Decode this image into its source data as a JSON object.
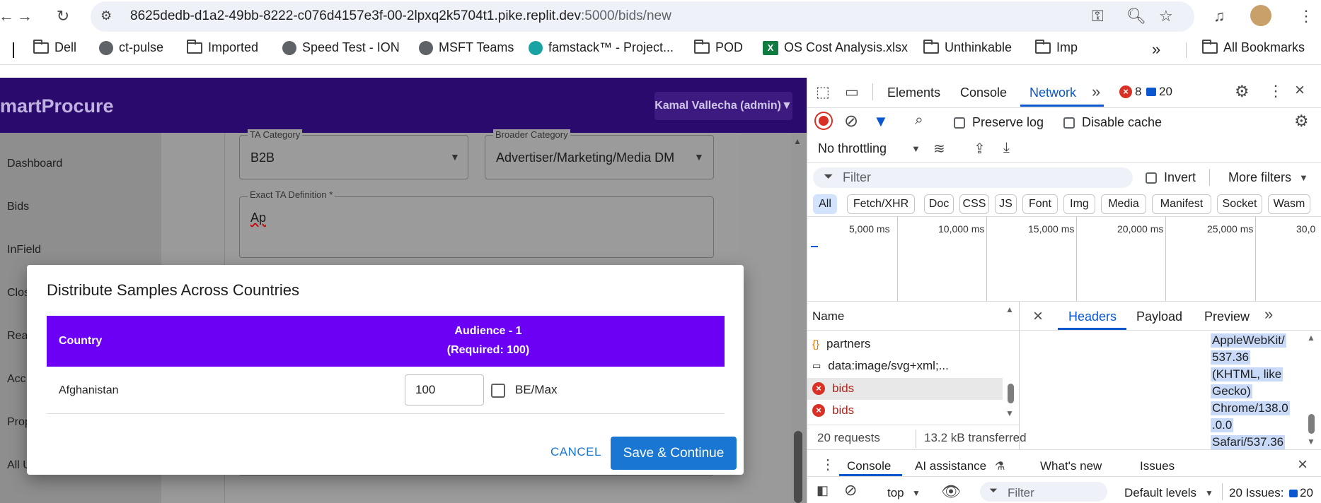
{
  "browser": {
    "url_host": "8625dedb-d1a2-49bb-8222-c076d4157e3f-00-2lpxq2k5704t1.pike.replit.dev",
    "url_path": ":5000/bids/new"
  },
  "bookmarks": {
    "items": [
      "Dell",
      "ct-pulse",
      "Imported",
      "Speed Test - ION",
      "MSFT Teams",
      "famstack™ - Project...",
      "POD",
      "OS Cost Analysis.xlsx",
      "Unthinkable",
      "Imp"
    ],
    "all_label": "All Bookmarks",
    "more": "»"
  },
  "app": {
    "brand": "martProcure",
    "user": "Kamal Vallecha (admin)▼",
    "sidebar": [
      "Dashboard",
      "Bids",
      "InField",
      "Clos",
      "Reac",
      "Acc",
      "Prop",
      "All U"
    ],
    "form": {
      "ta_category_label": "TA Category",
      "ta_category_value": "B2B",
      "broader_category_label": "Broader Category",
      "broader_category_value": "Advertiser/Marketing/Media DM",
      "exact_ta_label": "Exact TA Definition *",
      "exact_ta_value": "Ap"
    }
  },
  "dialog": {
    "title": "Distribute Samples Across Countries",
    "col_country": "Country",
    "col_audience": "Audience - 1",
    "col_required": "(Required: 100)",
    "rows": [
      {
        "country": "Afghanistan",
        "value": "100",
        "bemax_label": "BE/Max"
      }
    ],
    "cancel": "CANCEL",
    "save": "Save & Continue"
  },
  "devtools": {
    "tabs": [
      "Elements",
      "Console",
      "Network"
    ],
    "errors": "8",
    "issues_count": "20",
    "preserve_log": "Preserve log",
    "disable_cache": "Disable cache",
    "throttling": "No throttling",
    "filter_placeholder": "Filter",
    "invert": "Invert",
    "more_filters": "More filters",
    "chips": [
      "All",
      "Fetch/XHR",
      "Doc",
      "CSS",
      "JS",
      "Font",
      "Img",
      "Media",
      "Manifest",
      "Socket",
      "Wasm"
    ],
    "timeline": [
      "5,000 ms",
      "10,000 ms",
      "15,000 ms",
      "20,000 ms",
      "25,000 ms",
      "30,0"
    ],
    "name_col": "Name",
    "requests": [
      "partners",
      "data:image/svg+xml;...",
      "bids",
      "bids"
    ],
    "footer_requests": "20 requests",
    "footer_transferred": "13.2 kB transferred",
    "detail_tabs": [
      "Headers",
      "Payload",
      "Preview"
    ],
    "header_lines": [
      "AppleWebKit/",
      "537.36",
      "(KHTML, like",
      "Gecko)",
      "Chrome/138.0",
      ".0.0",
      "Safari/537.36"
    ],
    "drawer_tabs": [
      "Console",
      "AI assistance",
      "What's new",
      "Issues"
    ],
    "context": "top",
    "default_levels": "Default levels",
    "issues_label": "20 Issues:",
    "issues_num": "20"
  }
}
